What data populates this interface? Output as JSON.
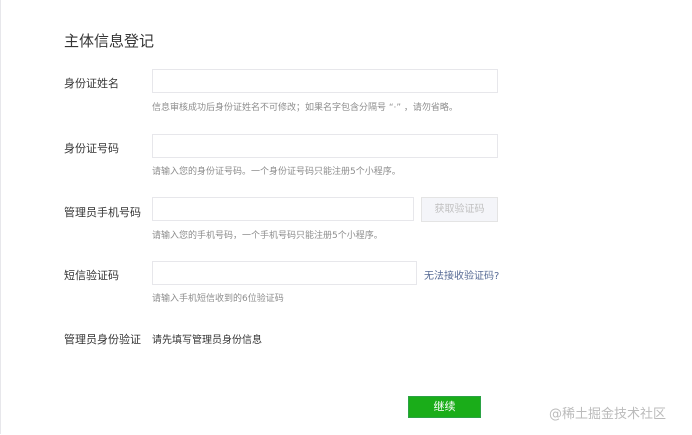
{
  "form": {
    "title": "主体信息登记",
    "fields": {
      "id_name": {
        "label": "身份证姓名",
        "value": "",
        "hint": "信息审核成功后身份证姓名不可修改；如果名字包含分隔号 “·” ，请勿省略。"
      },
      "id_number": {
        "label": "身份证号码",
        "value": "",
        "hint": "请输入您的身份证号码。一个身份证号码只能注册5个小程序。"
      },
      "admin_phone": {
        "label": "管理员手机号码",
        "value": "",
        "button": "获取验证码",
        "hint": "请输入您的手机号码，一个手机号码只能注册5个小程序。"
      },
      "sms_code": {
        "label": "短信验证码",
        "value": "",
        "link": "无法接收验证码?",
        "hint": "请输入手机短信收到的6位验证码"
      },
      "admin_verify": {
        "label": "管理员身份验证",
        "text": "请先填写管理员身份信息"
      }
    },
    "submit_label": "继续"
  },
  "watermark": "@稀土掘金技术社区",
  "colors": {
    "primary": "#1aad19",
    "link": "#576b95",
    "hint": "#8d8d8d",
    "border": "#e7e7eb"
  }
}
